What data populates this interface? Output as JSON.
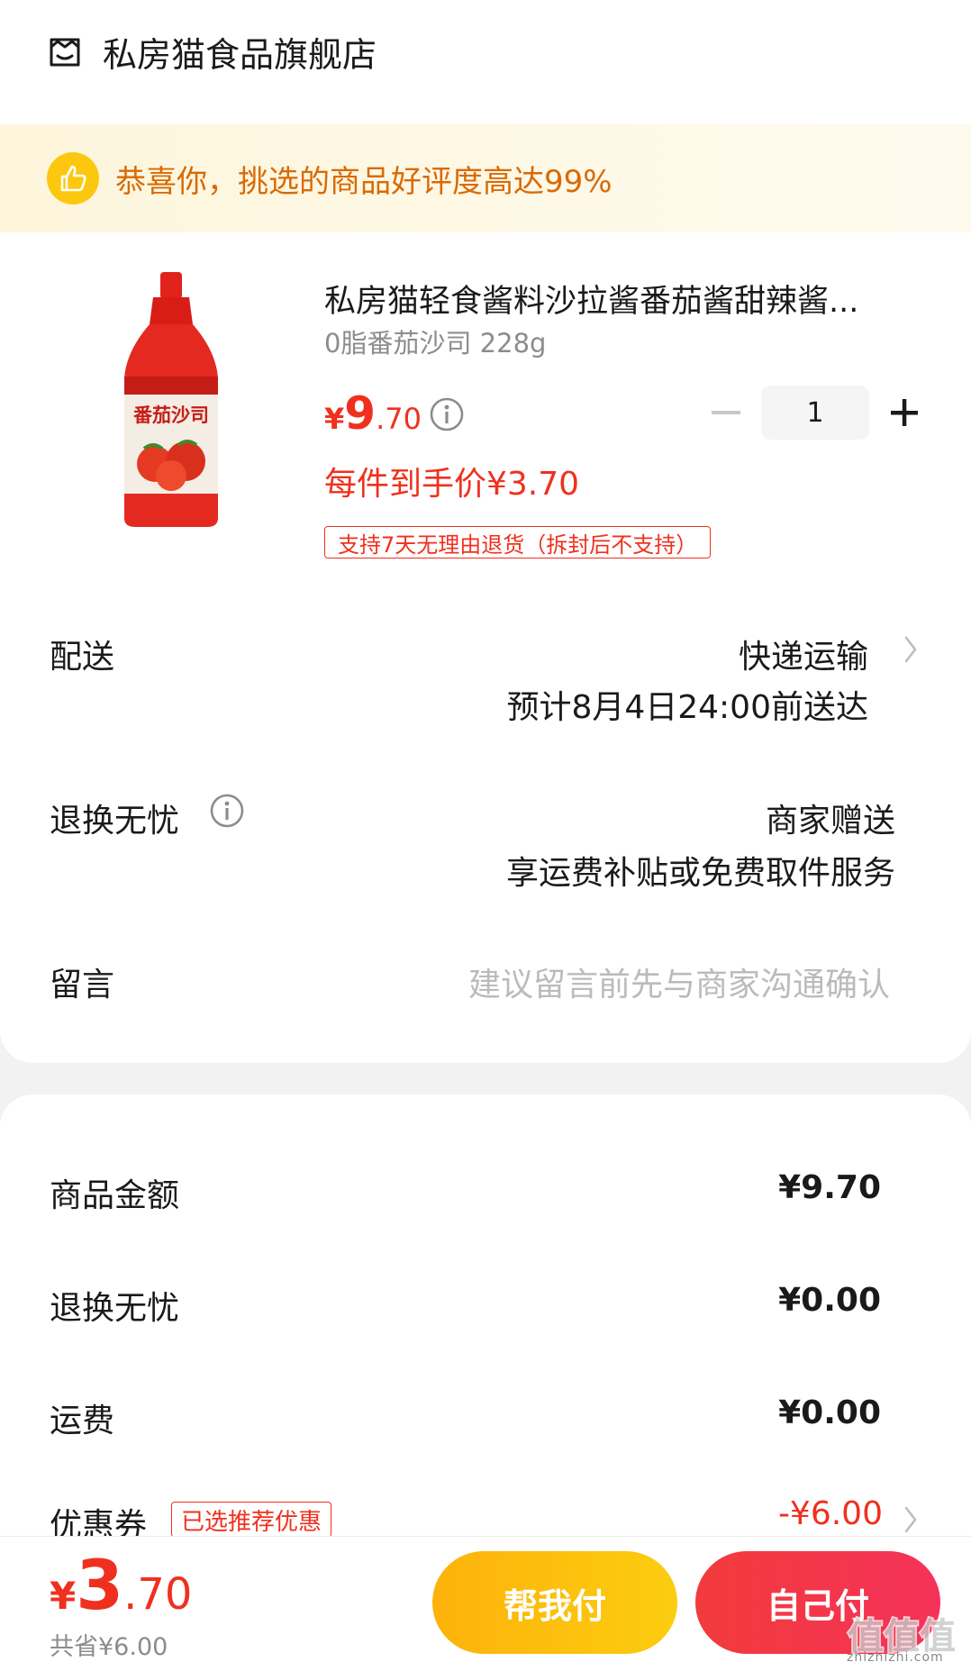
{
  "store": {
    "name": "私房猫食品旗舰店",
    "icon": "store-icon"
  },
  "banner": {
    "text": "恭喜你，挑选的商品好评度高达99%",
    "icon": "thumbs-up-icon",
    "accent": "#fcc80f",
    "text_color": "#d96a06"
  },
  "product": {
    "title": "私房猫轻食酱料沙拉酱番茄酱甜辣酱...",
    "spec": "0脂番茄沙司 228g",
    "price_symbol": "¥",
    "price_int": "9",
    "price_dec": ".70",
    "quantity": "1",
    "net_price": "每件到手价¥3.70",
    "return_tag": "支持7天无理由退货（拆封后不支持）",
    "image_label": "番茄沙司"
  },
  "delivery": {
    "label": "配送",
    "method": "快递运输",
    "eta": "预计8月4日24:00前送达"
  },
  "worry_free": {
    "label": "退换无忧",
    "value": "商家赠送",
    "detail": "享运费补贴或免费取件服务"
  },
  "message": {
    "label": "留言",
    "placeholder": "建议留言前先与商家沟通确认"
  },
  "summary": {
    "goods_label": "商品金额",
    "goods_value": "¥9.70",
    "worry_label": "退换无忧",
    "worry_value": "¥0.00",
    "shipping_label": "运费",
    "shipping_value": "¥0.00",
    "coupon_label": "优惠券",
    "coupon_tag": "已选推荐优惠",
    "coupon_value": "-¥6.00"
  },
  "footer": {
    "total_symbol": "¥",
    "total_int": "3",
    "total_dec": ".70",
    "saved": "共省¥6.00",
    "help_pay": "帮我付",
    "self_pay": "自己付",
    "watermark": "值值值",
    "watermark_url": "zhizhizhi.com"
  },
  "colors": {
    "accent_red": "#f0301e",
    "accent_yellow": "#fcc80f"
  }
}
